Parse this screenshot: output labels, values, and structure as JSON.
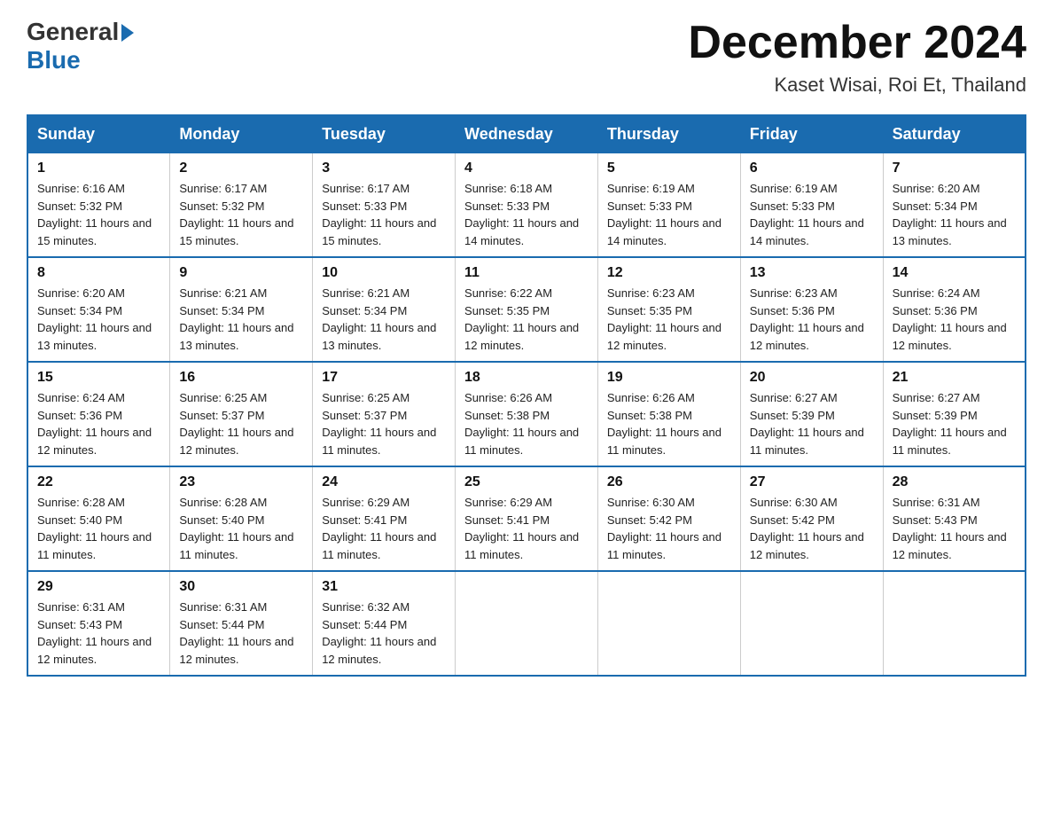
{
  "logo": {
    "general": "General",
    "blue": "Blue"
  },
  "title": "December 2024",
  "location": "Kaset Wisai, Roi Et, Thailand",
  "days_of_week": [
    "Sunday",
    "Monday",
    "Tuesday",
    "Wednesday",
    "Thursday",
    "Friday",
    "Saturday"
  ],
  "weeks": [
    [
      {
        "day": "1",
        "sunrise": "6:16 AM",
        "sunset": "5:32 PM",
        "daylight": "11 hours and 15 minutes."
      },
      {
        "day": "2",
        "sunrise": "6:17 AM",
        "sunset": "5:32 PM",
        "daylight": "11 hours and 15 minutes."
      },
      {
        "day": "3",
        "sunrise": "6:17 AM",
        "sunset": "5:33 PM",
        "daylight": "11 hours and 15 minutes."
      },
      {
        "day": "4",
        "sunrise": "6:18 AM",
        "sunset": "5:33 PM",
        "daylight": "11 hours and 14 minutes."
      },
      {
        "day": "5",
        "sunrise": "6:19 AM",
        "sunset": "5:33 PM",
        "daylight": "11 hours and 14 minutes."
      },
      {
        "day": "6",
        "sunrise": "6:19 AM",
        "sunset": "5:33 PM",
        "daylight": "11 hours and 14 minutes."
      },
      {
        "day": "7",
        "sunrise": "6:20 AM",
        "sunset": "5:34 PM",
        "daylight": "11 hours and 13 minutes."
      }
    ],
    [
      {
        "day": "8",
        "sunrise": "6:20 AM",
        "sunset": "5:34 PM",
        "daylight": "11 hours and 13 minutes."
      },
      {
        "day": "9",
        "sunrise": "6:21 AM",
        "sunset": "5:34 PM",
        "daylight": "11 hours and 13 minutes."
      },
      {
        "day": "10",
        "sunrise": "6:21 AM",
        "sunset": "5:34 PM",
        "daylight": "11 hours and 13 minutes."
      },
      {
        "day": "11",
        "sunrise": "6:22 AM",
        "sunset": "5:35 PM",
        "daylight": "11 hours and 12 minutes."
      },
      {
        "day": "12",
        "sunrise": "6:23 AM",
        "sunset": "5:35 PM",
        "daylight": "11 hours and 12 minutes."
      },
      {
        "day": "13",
        "sunrise": "6:23 AM",
        "sunset": "5:36 PM",
        "daylight": "11 hours and 12 minutes."
      },
      {
        "day": "14",
        "sunrise": "6:24 AM",
        "sunset": "5:36 PM",
        "daylight": "11 hours and 12 minutes."
      }
    ],
    [
      {
        "day": "15",
        "sunrise": "6:24 AM",
        "sunset": "5:36 PM",
        "daylight": "11 hours and 12 minutes."
      },
      {
        "day": "16",
        "sunrise": "6:25 AM",
        "sunset": "5:37 PM",
        "daylight": "11 hours and 12 minutes."
      },
      {
        "day": "17",
        "sunrise": "6:25 AM",
        "sunset": "5:37 PM",
        "daylight": "11 hours and 11 minutes."
      },
      {
        "day": "18",
        "sunrise": "6:26 AM",
        "sunset": "5:38 PM",
        "daylight": "11 hours and 11 minutes."
      },
      {
        "day": "19",
        "sunrise": "6:26 AM",
        "sunset": "5:38 PM",
        "daylight": "11 hours and 11 minutes."
      },
      {
        "day": "20",
        "sunrise": "6:27 AM",
        "sunset": "5:39 PM",
        "daylight": "11 hours and 11 minutes."
      },
      {
        "day": "21",
        "sunrise": "6:27 AM",
        "sunset": "5:39 PM",
        "daylight": "11 hours and 11 minutes."
      }
    ],
    [
      {
        "day": "22",
        "sunrise": "6:28 AM",
        "sunset": "5:40 PM",
        "daylight": "11 hours and 11 minutes."
      },
      {
        "day": "23",
        "sunrise": "6:28 AM",
        "sunset": "5:40 PM",
        "daylight": "11 hours and 11 minutes."
      },
      {
        "day": "24",
        "sunrise": "6:29 AM",
        "sunset": "5:41 PM",
        "daylight": "11 hours and 11 minutes."
      },
      {
        "day": "25",
        "sunrise": "6:29 AM",
        "sunset": "5:41 PM",
        "daylight": "11 hours and 11 minutes."
      },
      {
        "day": "26",
        "sunrise": "6:30 AM",
        "sunset": "5:42 PM",
        "daylight": "11 hours and 11 minutes."
      },
      {
        "day": "27",
        "sunrise": "6:30 AM",
        "sunset": "5:42 PM",
        "daylight": "11 hours and 12 minutes."
      },
      {
        "day": "28",
        "sunrise": "6:31 AM",
        "sunset": "5:43 PM",
        "daylight": "11 hours and 12 minutes."
      }
    ],
    [
      {
        "day": "29",
        "sunrise": "6:31 AM",
        "sunset": "5:43 PM",
        "daylight": "11 hours and 12 minutes."
      },
      {
        "day": "30",
        "sunrise": "6:31 AM",
        "sunset": "5:44 PM",
        "daylight": "11 hours and 12 minutes."
      },
      {
        "day": "31",
        "sunrise": "6:32 AM",
        "sunset": "5:44 PM",
        "daylight": "11 hours and 12 minutes."
      },
      null,
      null,
      null,
      null
    ]
  ]
}
